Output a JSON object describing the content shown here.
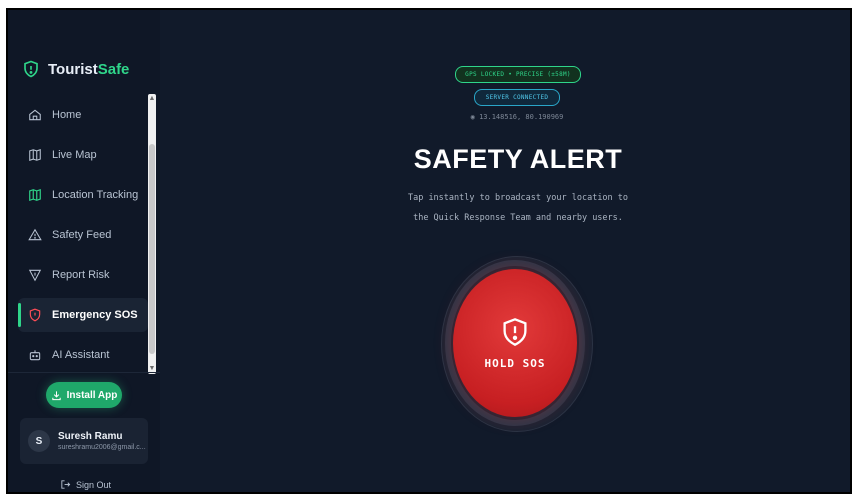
{
  "brand": {
    "name_main": "Tourist",
    "name_accent": "Safe"
  },
  "sidebar": {
    "items": [
      {
        "label": "Home",
        "icon": "home-icon"
      },
      {
        "label": "Live Map",
        "icon": "map-icon"
      },
      {
        "label": "Location Tracking",
        "icon": "map-icon"
      },
      {
        "label": "Safety Feed",
        "icon": "warning-icon"
      },
      {
        "label": "Report Risk",
        "icon": "triangle-down-icon"
      },
      {
        "label": "Emergency SOS",
        "icon": "shield-alert-icon",
        "active": true
      },
      {
        "label": "AI Assistant",
        "icon": "bot-icon"
      }
    ],
    "install_label": "Install App",
    "user": {
      "initial": "S",
      "name": "Suresh Ramu",
      "email": "sureshramu2006@gmail.c..."
    },
    "signout_label": "Sign Out"
  },
  "status": {
    "gps": "GPS LOCKED • PRECISE (±58M)",
    "server": "SERVER CONNECTED",
    "coords": "◉ 13.148516, 80.190969"
  },
  "main": {
    "title": "SAFETY ALERT",
    "subtitle_line1": "Tap instantly to broadcast your location to",
    "subtitle_line2": "the Quick Response Team and nearby users.",
    "sos_label": "HOLD SOS"
  },
  "colors": {
    "accent": "#2fd58a",
    "sos": "#d92b2b",
    "background": "#111a2a",
    "sidebar": "#0f1726"
  }
}
